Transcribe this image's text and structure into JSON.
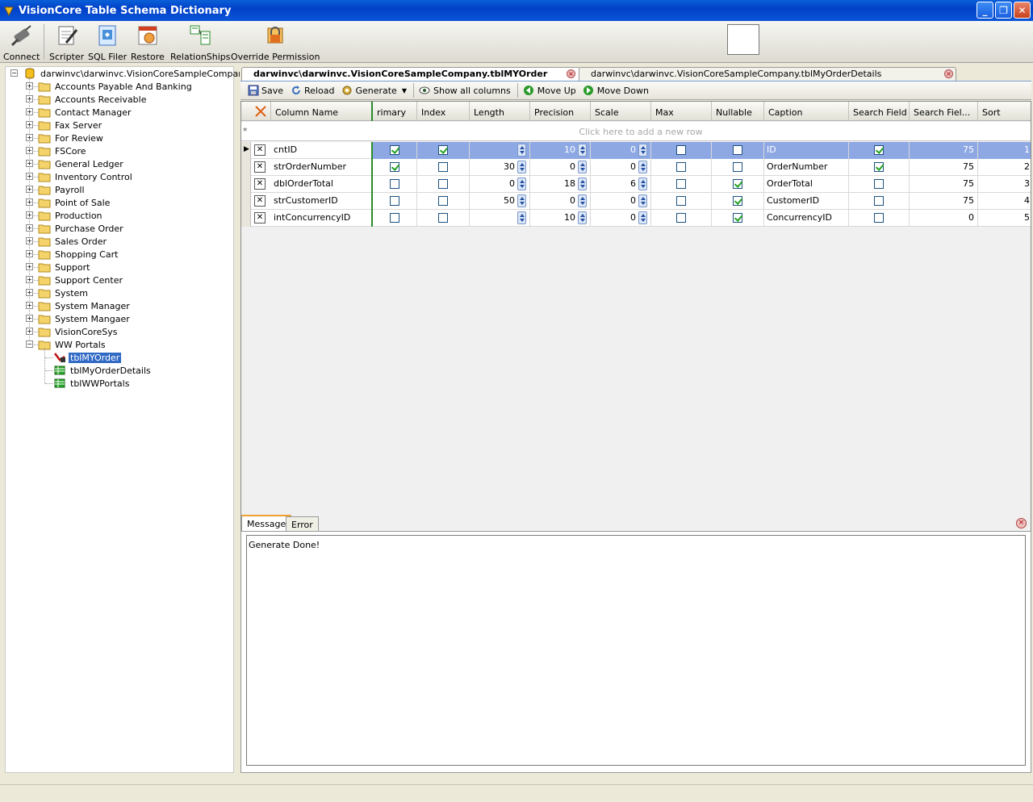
{
  "window": {
    "title": "VisionCore Table Schema Dictionary",
    "minimize": "_",
    "restore": "❐",
    "close": "✕"
  },
  "toolbar": {
    "connect": "Connect",
    "scripter": "Scripter",
    "sql_filer": "SQL Filer",
    "restore": "Restore",
    "relationships": "RelationShips",
    "override_permission": "Override Permission"
  },
  "tree": {
    "root": "darwinvc\\darwinvc.VisionCoreSampleCompany",
    "folders": [
      "Accounts Payable And Banking",
      "Accounts Receivable",
      "Contact Manager",
      "Fax Server",
      "For Review",
      "FSCore",
      "General Ledger",
      "Inventory Control",
      "Payroll",
      "Point of Sale",
      "Production",
      "Purchase Order",
      "Sales Order",
      "Shopping Cart",
      "Support",
      "Support Center",
      "System",
      "System Manager",
      "System Mangaer",
      "VisionCoreSys",
      "WW Portals"
    ],
    "expanded_children": [
      "tblMYOrder",
      "tblMyOrderDetails",
      "tblWWPortals"
    ],
    "selected": "tblMYOrder"
  },
  "doc_tabs": [
    {
      "label": "darwinvc\\darwinvc.VisionCoreSampleCompany.tblMYOrder",
      "active": true
    },
    {
      "label": "darwinvc\\darwinvc.VisionCoreSampleCompany.tblMyOrderDetails",
      "active": false
    }
  ],
  "grid_toolbar": {
    "save": "Save",
    "reload": "Reload",
    "generate": "Generate",
    "show_all_columns": "Show all columns",
    "move_up": "Move Up",
    "move_down": "Move Down"
  },
  "grid": {
    "columns": [
      "Column Name",
      "rimary",
      "Index",
      "Length",
      "Precision",
      "Scale",
      "Max",
      "Nullable",
      "Caption",
      "Search Field",
      "Search Fiel...",
      "Sort"
    ],
    "new_row_hint": "Click here to add a new row",
    "rows": [
      {
        "name": "cntID",
        "primary": true,
        "index": true,
        "length": "",
        "precision": "10",
        "scale": "0",
        "max": false,
        "nullable": false,
        "caption": "ID",
        "search_field": true,
        "search_width": "75",
        "sort": "1"
      },
      {
        "name": "strOrderNumber",
        "primary": true,
        "index": false,
        "length": "30",
        "precision": "0",
        "scale": "0",
        "max": false,
        "nullable": false,
        "caption": "OrderNumber",
        "search_field": true,
        "search_width": "75",
        "sort": "2"
      },
      {
        "name": "dblOrderTotal",
        "primary": false,
        "index": false,
        "length": "0",
        "precision": "18",
        "scale": "6",
        "max": false,
        "nullable": true,
        "caption": "OrderTotal",
        "search_field": false,
        "search_width": "75",
        "sort": "3"
      },
      {
        "name": "strCustomerID",
        "primary": false,
        "index": false,
        "length": "50",
        "precision": "0",
        "scale": "0",
        "max": false,
        "nullable": true,
        "caption": "CustomerID",
        "search_field": false,
        "search_width": "75",
        "sort": "4"
      },
      {
        "name": "intConcurrencyID",
        "primary": false,
        "index": false,
        "length": "",
        "precision": "10",
        "scale": "0",
        "max": false,
        "nullable": true,
        "caption": "ConcurrencyID",
        "search_field": false,
        "search_width": "0",
        "sort": "5"
      }
    ]
  },
  "messages": {
    "tab_message": "Message",
    "tab_error": "Error",
    "text": "Generate Done!"
  }
}
